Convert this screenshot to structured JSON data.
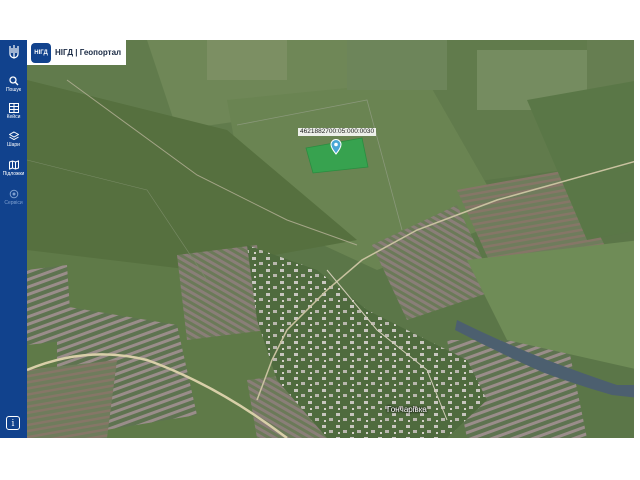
{
  "app": {
    "logo_text": "НІГД",
    "title": "НІГД | Геопортал"
  },
  "sidebar": {
    "items": [
      {
        "label": "Пошук",
        "icon": "search-icon"
      },
      {
        "label": "Кейси",
        "icon": "grid-icon"
      },
      {
        "label": "Шари",
        "icon": "layers-icon"
      },
      {
        "label": "Підложки",
        "icon": "map-icon"
      },
      {
        "label": "Сервіси",
        "icon": "services-icon",
        "disabled": true
      }
    ],
    "info_icon": "i"
  },
  "map": {
    "parcel_label": "4621882700:05:000:0030",
    "village_label": "Гончарівка",
    "colors": {
      "parcel": "#2fa84f",
      "marker": "#4aa7d6",
      "sidebar": "#11428d"
    }
  }
}
